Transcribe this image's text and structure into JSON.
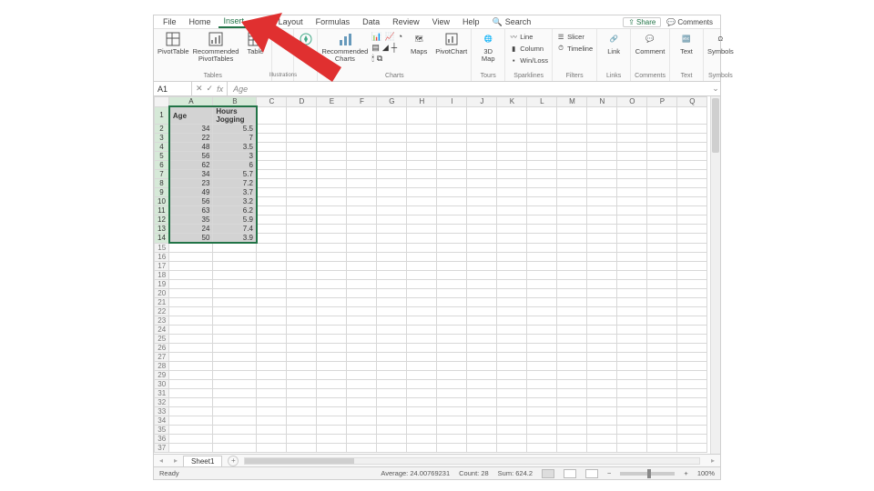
{
  "tabs": {
    "file": "File",
    "home": "Home",
    "insert": "Insert",
    "pagelayout": "Page Layout",
    "formulas": "Formulas",
    "data": "Data",
    "review": "Review",
    "view": "View",
    "help": "Help",
    "search": "Search"
  },
  "topright": {
    "share": "Share",
    "comments": "Comments"
  },
  "ribbon": {
    "tables": {
      "pivottable": "PivotTable",
      "recpivot": "Recommended\nPivotTables",
      "table": "Table",
      "label": "Tables"
    },
    "illus": {
      "label": "Illustrations"
    },
    "addins": {
      "btn": "Add-\nins"
    },
    "charts": {
      "rec": "Recommended\nCharts",
      "maps": "Maps",
      "pivotchart": "PivotChart",
      "label": "Charts"
    },
    "tours": {
      "map": "3D\nMap",
      "label": "Tours"
    },
    "spark": {
      "line": "Line",
      "column": "Column",
      "winloss": "Win/Loss",
      "label": "Sparklines"
    },
    "filters": {
      "slicer": "Slicer",
      "timeline": "Timeline",
      "label": "Filters"
    },
    "links": {
      "link": "Link",
      "label": "Links"
    },
    "comments": {
      "comment": "Comment",
      "label": "Comments"
    },
    "text": {
      "text": "Text",
      "label": "Text"
    },
    "symbols": {
      "symbols": "Symbols",
      "label": "Symbols"
    }
  },
  "fx": {
    "namebox": "A1",
    "fxlabel": "fx",
    "value": "Age"
  },
  "columns": [
    "A",
    "B",
    "C",
    "D",
    "E",
    "F",
    "G",
    "H",
    "I",
    "J",
    "K",
    "L",
    "M",
    "N",
    "O",
    "P",
    "Q"
  ],
  "data_rows": [
    {
      "n": 1,
      "a": "Age",
      "b": "Hours Jogging",
      "hdr": true
    },
    {
      "n": 2,
      "a": "34",
      "b": "5.5"
    },
    {
      "n": 3,
      "a": "22",
      "b": "7"
    },
    {
      "n": 4,
      "a": "48",
      "b": "3.5"
    },
    {
      "n": 5,
      "a": "56",
      "b": "3"
    },
    {
      "n": 6,
      "a": "62",
      "b": "6"
    },
    {
      "n": 7,
      "a": "34",
      "b": "5.7"
    },
    {
      "n": 8,
      "a": "23",
      "b": "7.2"
    },
    {
      "n": 9,
      "a": "49",
      "b": "3.7"
    },
    {
      "n": 10,
      "a": "56",
      "b": "3.2"
    },
    {
      "n": 11,
      "a": "63",
      "b": "6.2"
    },
    {
      "n": 12,
      "a": "35",
      "b": "5.9"
    },
    {
      "n": 13,
      "a": "24",
      "b": "7.4"
    },
    {
      "n": 14,
      "a": "50",
      "b": "3.9"
    }
  ],
  "empty_rows": [
    15,
    16,
    17,
    18,
    19,
    20,
    21,
    22,
    23,
    24,
    25,
    26,
    27,
    28,
    29,
    30,
    31,
    32,
    33,
    34,
    35,
    36,
    37
  ],
  "sheet": {
    "name": "Sheet1"
  },
  "status": {
    "ready": "Ready",
    "avg": "Average: 24.00769231",
    "count": "Count: 28",
    "sum": "Sum: 624.2",
    "zoom": "100%"
  }
}
